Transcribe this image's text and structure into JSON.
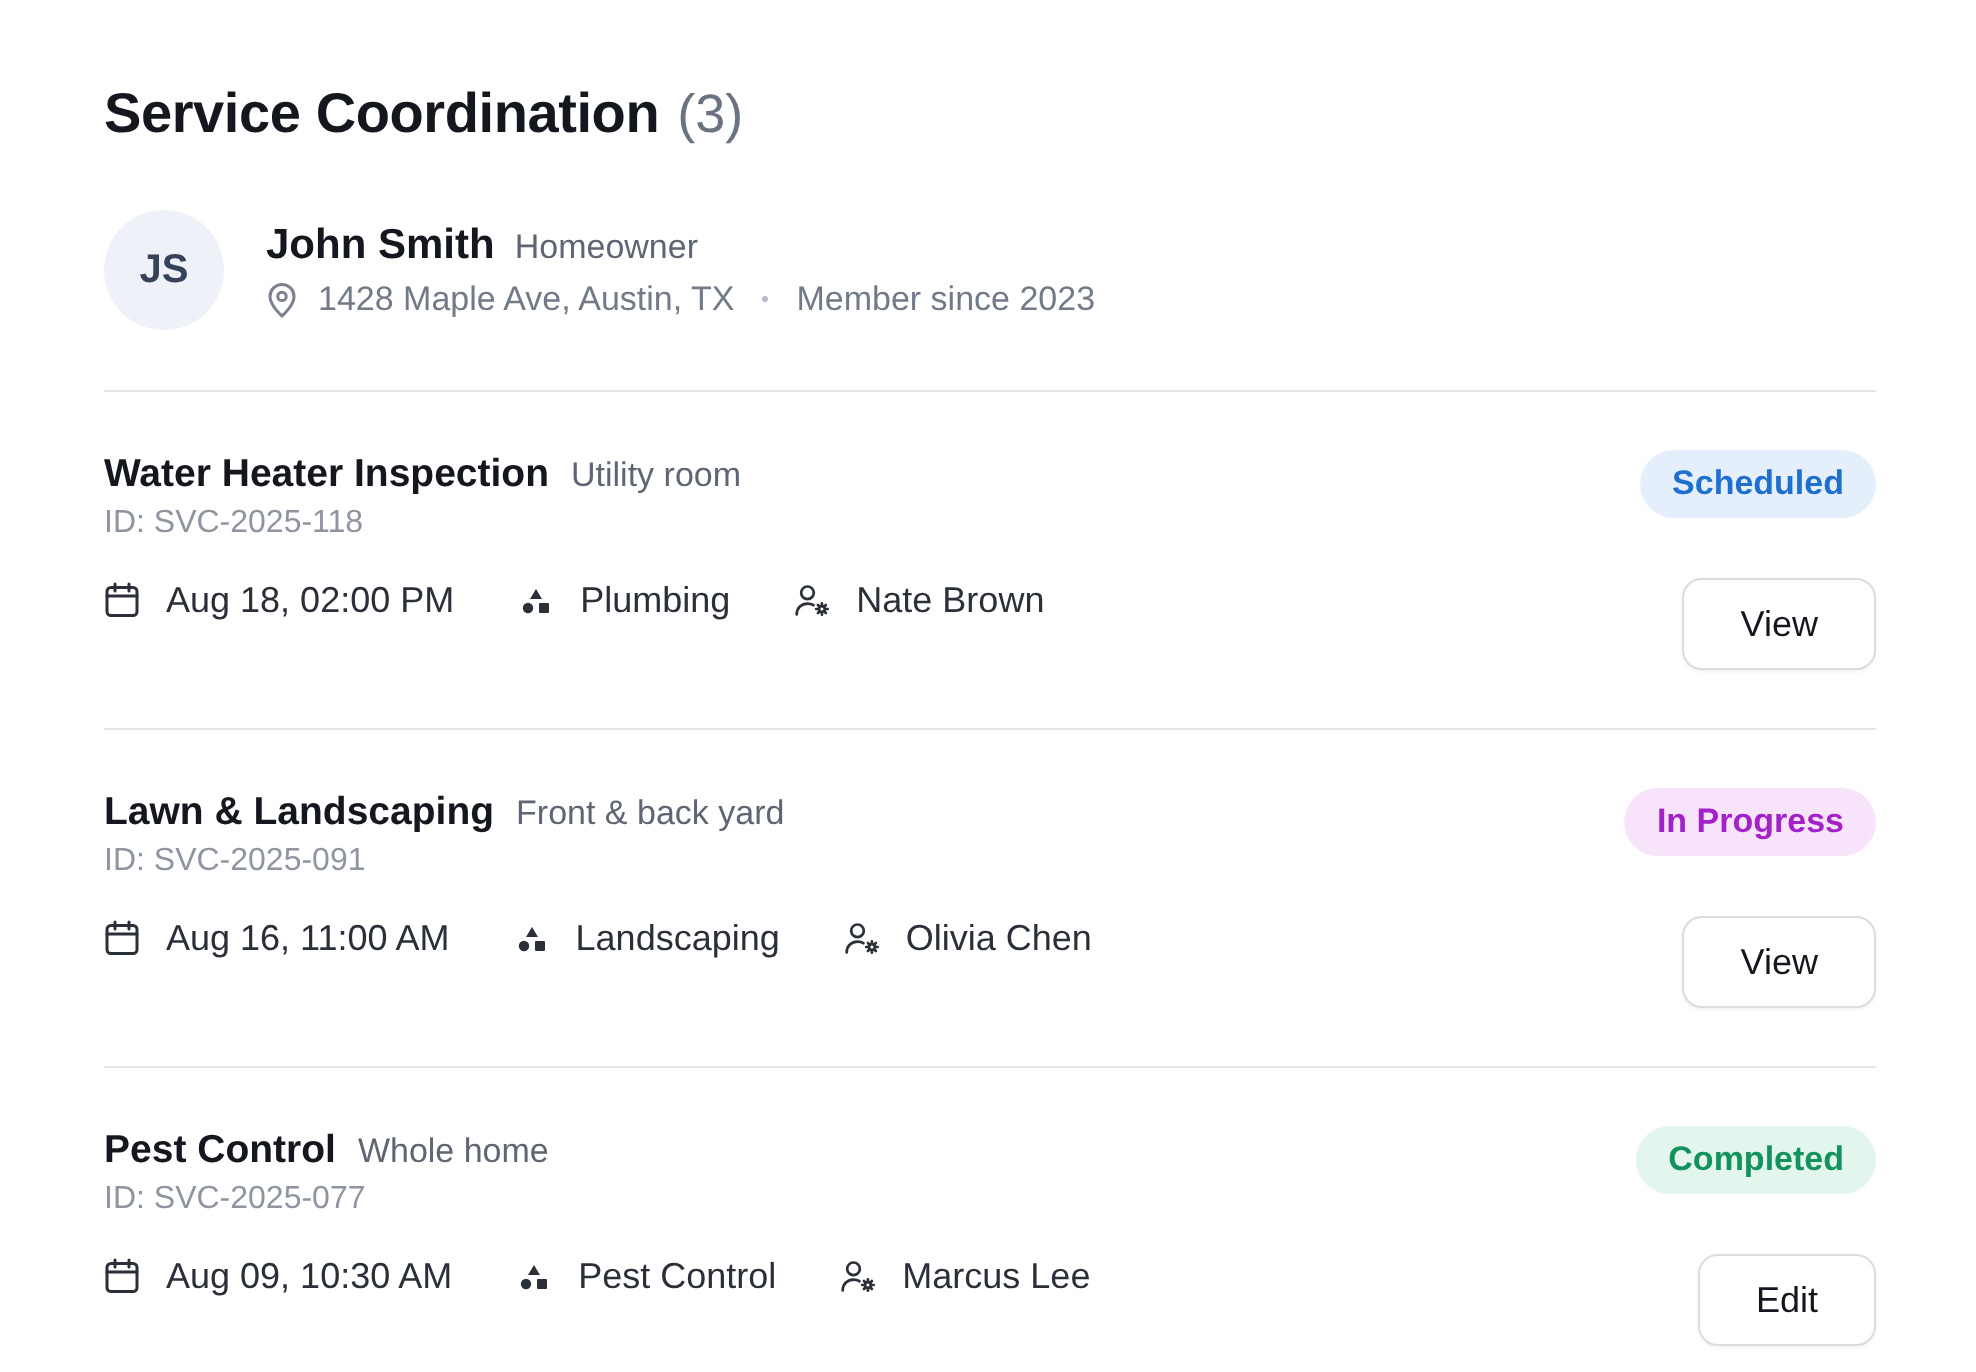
{
  "header": {
    "title": "Service Coordination",
    "count": "(3)"
  },
  "customer": {
    "initials": "JS",
    "name": "John Smith",
    "role": "Homeowner",
    "address": "1428 Maple Ave, Austin, TX",
    "member_since": "Member since 2023"
  },
  "services": [
    {
      "title": "Water Heater Inspection",
      "location": "Utility room",
      "id": "ID: SVC-2025-118",
      "date": "Aug 18, 02:00 PM",
      "category": "Plumbing",
      "technician": "Nate Brown",
      "status": {
        "label": "Scheduled",
        "kind": "scheduled"
      },
      "action": "View"
    },
    {
      "title": "Lawn & Landscaping",
      "location": "Front & back yard",
      "id": "ID: SVC-2025-091",
      "date": "Aug 16, 11:00 AM",
      "category": "Landscaping",
      "technician": "Olivia Chen",
      "status": {
        "label": "In Progress",
        "kind": "in_progress"
      },
      "action": "View"
    },
    {
      "title": "Pest Control",
      "location": "Whole home",
      "id": "ID: SVC-2025-077",
      "date": "Aug 09, 10:30 AM",
      "category": "Pest Control",
      "technician": "Marcus Lee",
      "status": {
        "label": "Completed",
        "kind": "completed"
      },
      "action": "Edit"
    }
  ]
}
